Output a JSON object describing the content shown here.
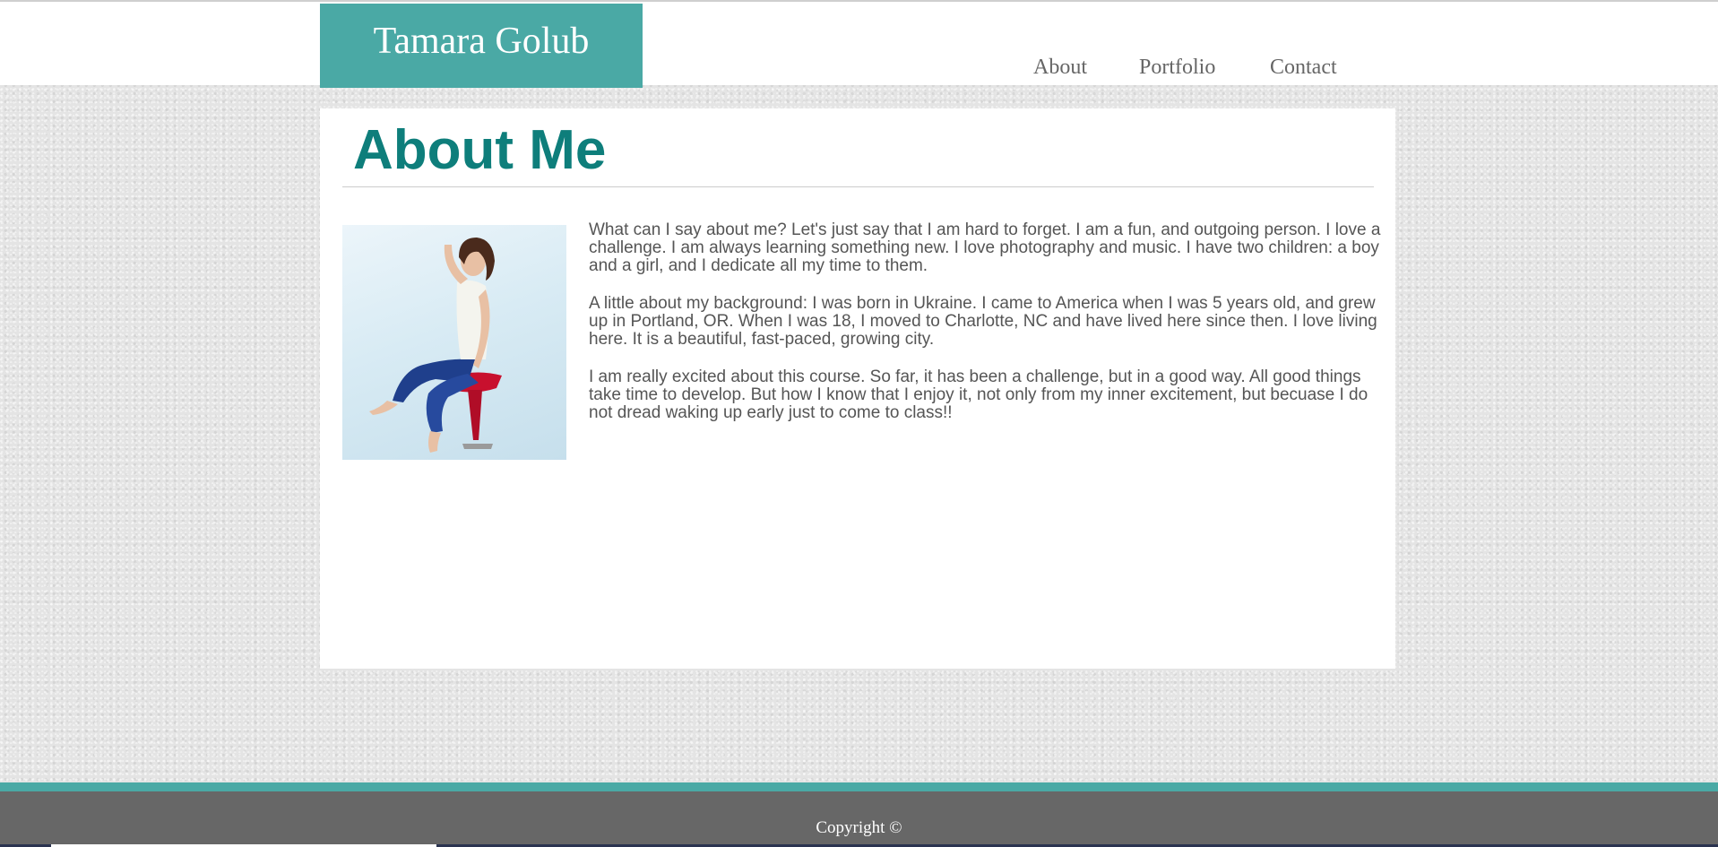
{
  "header": {
    "site_title": "Tamara Golub",
    "nav": [
      "About",
      "Portfolio",
      "Contact"
    ]
  },
  "main": {
    "heading": "About Me",
    "paragraphs": [
      "What can I say about me? Let's just say that I am hard to forget. I am a fun, and outgoing person. I love a challenge. I am always learning something new. I love photography and music. I have two children: a boy and a girl, and I dedicate all my time to them.",
      "A little about my background: I was born in Ukraine. I came to America when I was 5 years old, and grew up in Portland, OR. When I was 18, I moved to Charlotte, NC and have lived here since then. I love living here. It is a beautiful, fast-paced, growing city.",
      "I am really excited about this course. So far, it has been a challenge, but in a good way. All good things take time to develop. But how I know that I enjoy it, not only from my inner excitement, but becuase I do not dread waking up early just to come to class!!"
    ]
  },
  "footer": {
    "copyright": "Copyright ©"
  },
  "colors": {
    "accent": "#4aa9a5",
    "heading": "#0e7e7b",
    "footer": "#676767"
  }
}
